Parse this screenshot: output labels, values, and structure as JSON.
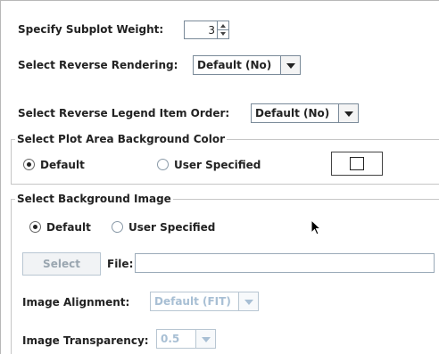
{
  "subplot_weight": {
    "label": "Specify Subplot Weight:",
    "value": "3"
  },
  "reverse_rendering": {
    "label": "Select Reverse Rendering:",
    "value": "Default (No)"
  },
  "reverse_legend": {
    "label": "Select Reverse Legend Item Order:",
    "value": "Default (No)"
  },
  "plot_bg_color": {
    "title": "Select Plot Area Background Color",
    "option_default": "Default",
    "option_user": "User Specified",
    "selected": "Default",
    "swatch_color": "#ffffff"
  },
  "bg_image": {
    "title": "Select Background Image",
    "option_default": "Default",
    "option_user": "User Specified",
    "selected": "Default",
    "select_button": "Select",
    "file_label": "File:",
    "file_value": "",
    "alignment_label": "Image Alignment:",
    "alignment_value": "Default (FIT)",
    "transparency_label": "Image Transparency:",
    "transparency_value": "0.5"
  }
}
